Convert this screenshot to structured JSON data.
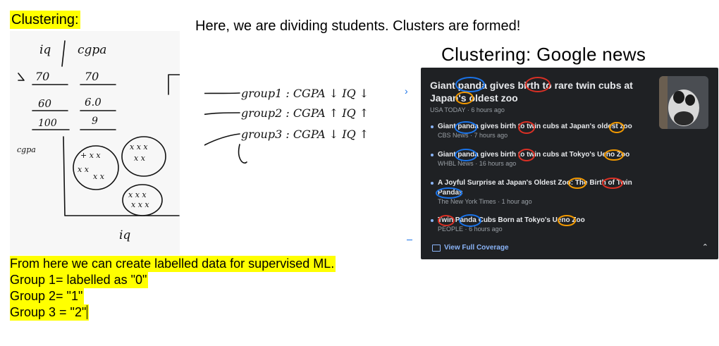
{
  "heading": "Clustering:",
  "intro": "Here, we are dividing students. Clusters are formed!",
  "board": {
    "col_a": "iq",
    "col_b": "cgpa",
    "rows": [
      [
        "70",
        "70"
      ],
      [
        "60",
        "6.0"
      ],
      [
        "100",
        "9"
      ]
    ],
    "y_label": "cgpa",
    "x_label": "iq"
  },
  "groups": [
    "group1 : CGPA ↓ IQ ↓",
    "group2 : CGPA ↑ IQ ↑",
    "group3 : CGPA ↓ IQ ↑"
  ],
  "google_news": {
    "title": "Clustering: Google news",
    "main_story": {
      "title": "Giant panda gives birth to rare twin cubs at Japan's oldest zoo",
      "source": "USA TODAY",
      "time": "6 hours ago"
    },
    "stories": [
      {
        "title": "Giant panda gives birth to twin cubs at Japan's oldest zoo",
        "source": "CBS News",
        "time": "7 hours ago"
      },
      {
        "title": "Giant panda gives birth to twin cubs at Tokyo's Ueno Zoo",
        "source": "WHBL News",
        "time": "16 hours ago"
      },
      {
        "title": "A Joyful Surprise at Japan's Oldest Zoo: The Birth of Twin Pandas",
        "source": "The New York Times",
        "time": "1 hour ago"
      },
      {
        "title": "Twin Panda Cubs Born at Tokyo's Ueno Zoo",
        "source": "PEOPLE",
        "time": "6 hours ago"
      }
    ],
    "view_full_coverage": "View Full Coverage",
    "separator": "·"
  },
  "notes": [
    "From here we can create labelled data for supervised ML.",
    "Group 1= labelled as \"0\"",
    "Group 2=  \"1\"",
    "Group 3 = \"2\""
  ]
}
